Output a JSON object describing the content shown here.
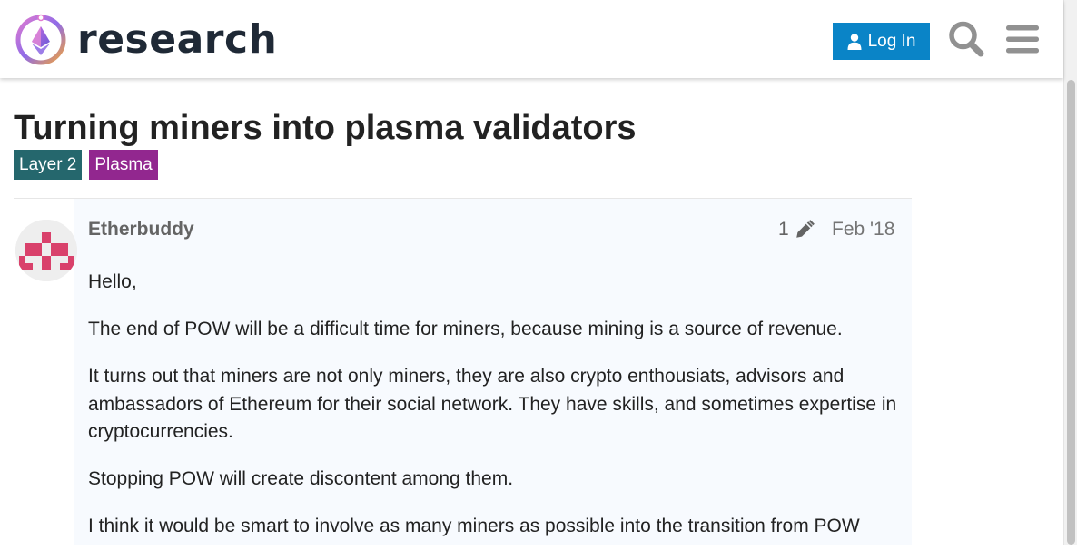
{
  "header": {
    "site_name": "research",
    "login_label": "Log In",
    "colors": {
      "accent": "#0a84c7",
      "logo_text": "#1f2936"
    },
    "icons": {
      "user": "user-icon",
      "search": "search-icon",
      "menu": "hamburger-menu-icon"
    }
  },
  "topic": {
    "title": "Turning miners into plasma validators",
    "tags": [
      {
        "label": "Layer 2",
        "color": "#25676d"
      },
      {
        "label": "Plasma",
        "color": "#92278f"
      }
    ]
  },
  "post": {
    "username": "Etherbuddy",
    "edit_count": "1",
    "date": "Feb '18",
    "icons": {
      "edit": "pencil-icon"
    },
    "paragraphs": [
      "Hello,",
      "The end of POW will be a difficult time for miners, because mining is a source of revenue.",
      "It turns out that miners are not only miners, they are also crypto enthousiats, advisors and ambassadors of Ethereum for their social network. They have skills, and sometimes expertise in cryptocurrencies.",
      "Stopping POW will create discontent among them.",
      "I think it would be smart to involve as many miners as possible into the transition from POW"
    ]
  }
}
